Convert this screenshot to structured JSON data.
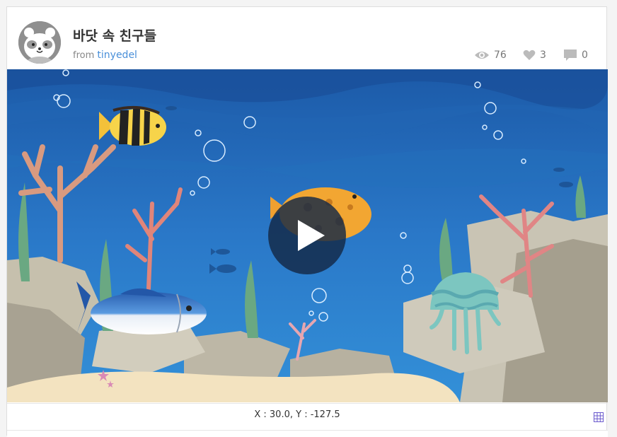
{
  "project": {
    "title": "바닷 속 친구들",
    "from_label": "from",
    "author": "tinyedel"
  },
  "stats": {
    "views": "76",
    "likes": "3",
    "comments": "0"
  },
  "stage": {
    "coords": "X : 30.0, Y : -127.5"
  },
  "icons": {
    "views": "eye-icon",
    "likes": "heart-icon",
    "comments": "comment-icon",
    "play": "play-icon",
    "grid": "grid-icon"
  },
  "colors": {
    "water_top": "#1e5fae",
    "water_bottom": "#2f86d2",
    "sand": "#f3e3c0",
    "rock": "#c9c4b4",
    "accent": "#4a90d9"
  }
}
